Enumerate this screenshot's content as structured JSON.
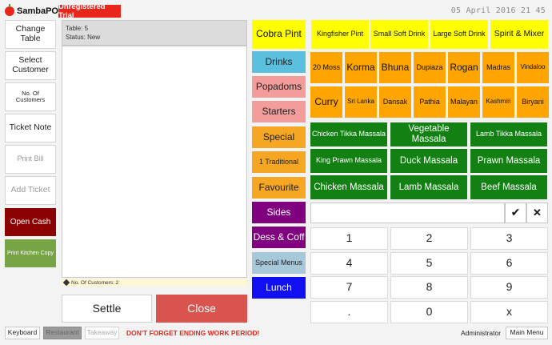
{
  "header": {
    "app_name": "SambaPOS",
    "trial_badge": "Unregistered Trial",
    "clock": "05 April 2016 21 45"
  },
  "left_actions": {
    "change_table": "Change Table",
    "select_customer": "Select Customer",
    "no_of_customers": "No. Of Customers",
    "ticket_note": "Ticket Note",
    "print_bill": "Print Bill",
    "add_ticket": "Add Ticket",
    "open_cash": "Open Cash",
    "print_kitchen_copy": "Print Kitchen Copy"
  },
  "ticket": {
    "table": "Table: 5",
    "status": "Status: New",
    "footer_note": "No. Of Customers: 2",
    "settle_label": "Settle",
    "close_label": "Close"
  },
  "categories": [
    {
      "label": "Drinks",
      "color": "#5bc0de"
    },
    {
      "label": "Popadoms",
      "color": "#f29c9c"
    },
    {
      "label": "Starters",
      "color": "#f29c9c"
    },
    {
      "label": "Special",
      "color": "#f5a623"
    },
    {
      "label": "1 Traditional",
      "color": "#f5a623"
    },
    {
      "label": "Favourite",
      "color": "#f5a623"
    },
    {
      "label": "Sides",
      "color": "#800080"
    },
    {
      "label": "Dess & Coff",
      "color": "#800080"
    },
    {
      "label": "Special Menus",
      "color": "#a6c8d8"
    },
    {
      "label": "Lunch",
      "color": "#1010f0"
    }
  ],
  "drinks": [
    {
      "label": "Cobra Pint",
      "color": "#ffff00"
    },
    {
      "label": "Kingfisher Pint",
      "color": "#ffff00"
    },
    {
      "label": "Small Soft Drink",
      "color": "#ffff00"
    },
    {
      "label": "Large Soft Drink",
      "color": "#ffff00"
    },
    {
      "label": "Spirit & Mixer",
      "color": "#ffff00"
    }
  ],
  "curries_row1": [
    "20 Moss",
    "Korma",
    "Bhuna",
    "Dupiaza",
    "Rogan",
    "Madras",
    "Vindaloo"
  ],
  "curries_row2": [
    "Curry",
    "Sri Lanka",
    "Dansak",
    "Pathia",
    "Malayan",
    "Kashmiri",
    "Biryani"
  ],
  "massalas": [
    [
      "Chicken Tikka Massala",
      "Vegetable Massala",
      "Lamb Tikka Massala"
    ],
    [
      "King Prawn Massala",
      "Duck Massala",
      "Prawn Massala"
    ],
    [
      "Chicken Massala",
      "Lamb Massala",
      "Beef Massala"
    ]
  ],
  "colors": {
    "curry": "#ffa500",
    "massala": "#128012",
    "open_cash": "#8b0000",
    "print_kitchen": "#77a445"
  },
  "numpad": {
    "check_icon": "check-icon",
    "clear_icon": "close-icon",
    "keys": [
      "1",
      "2",
      "3",
      "4",
      "5",
      "6",
      "7",
      "8",
      "9",
      ".",
      "0",
      "x"
    ]
  },
  "footer": {
    "keyboard": "Keyboard",
    "restaurant": "Restaurant",
    "takeaway": "Takeaway",
    "warning": "DON'T FORGET ENDING WORK PERIOD!",
    "user": "Administrator",
    "main_menu": "Main Menu"
  }
}
